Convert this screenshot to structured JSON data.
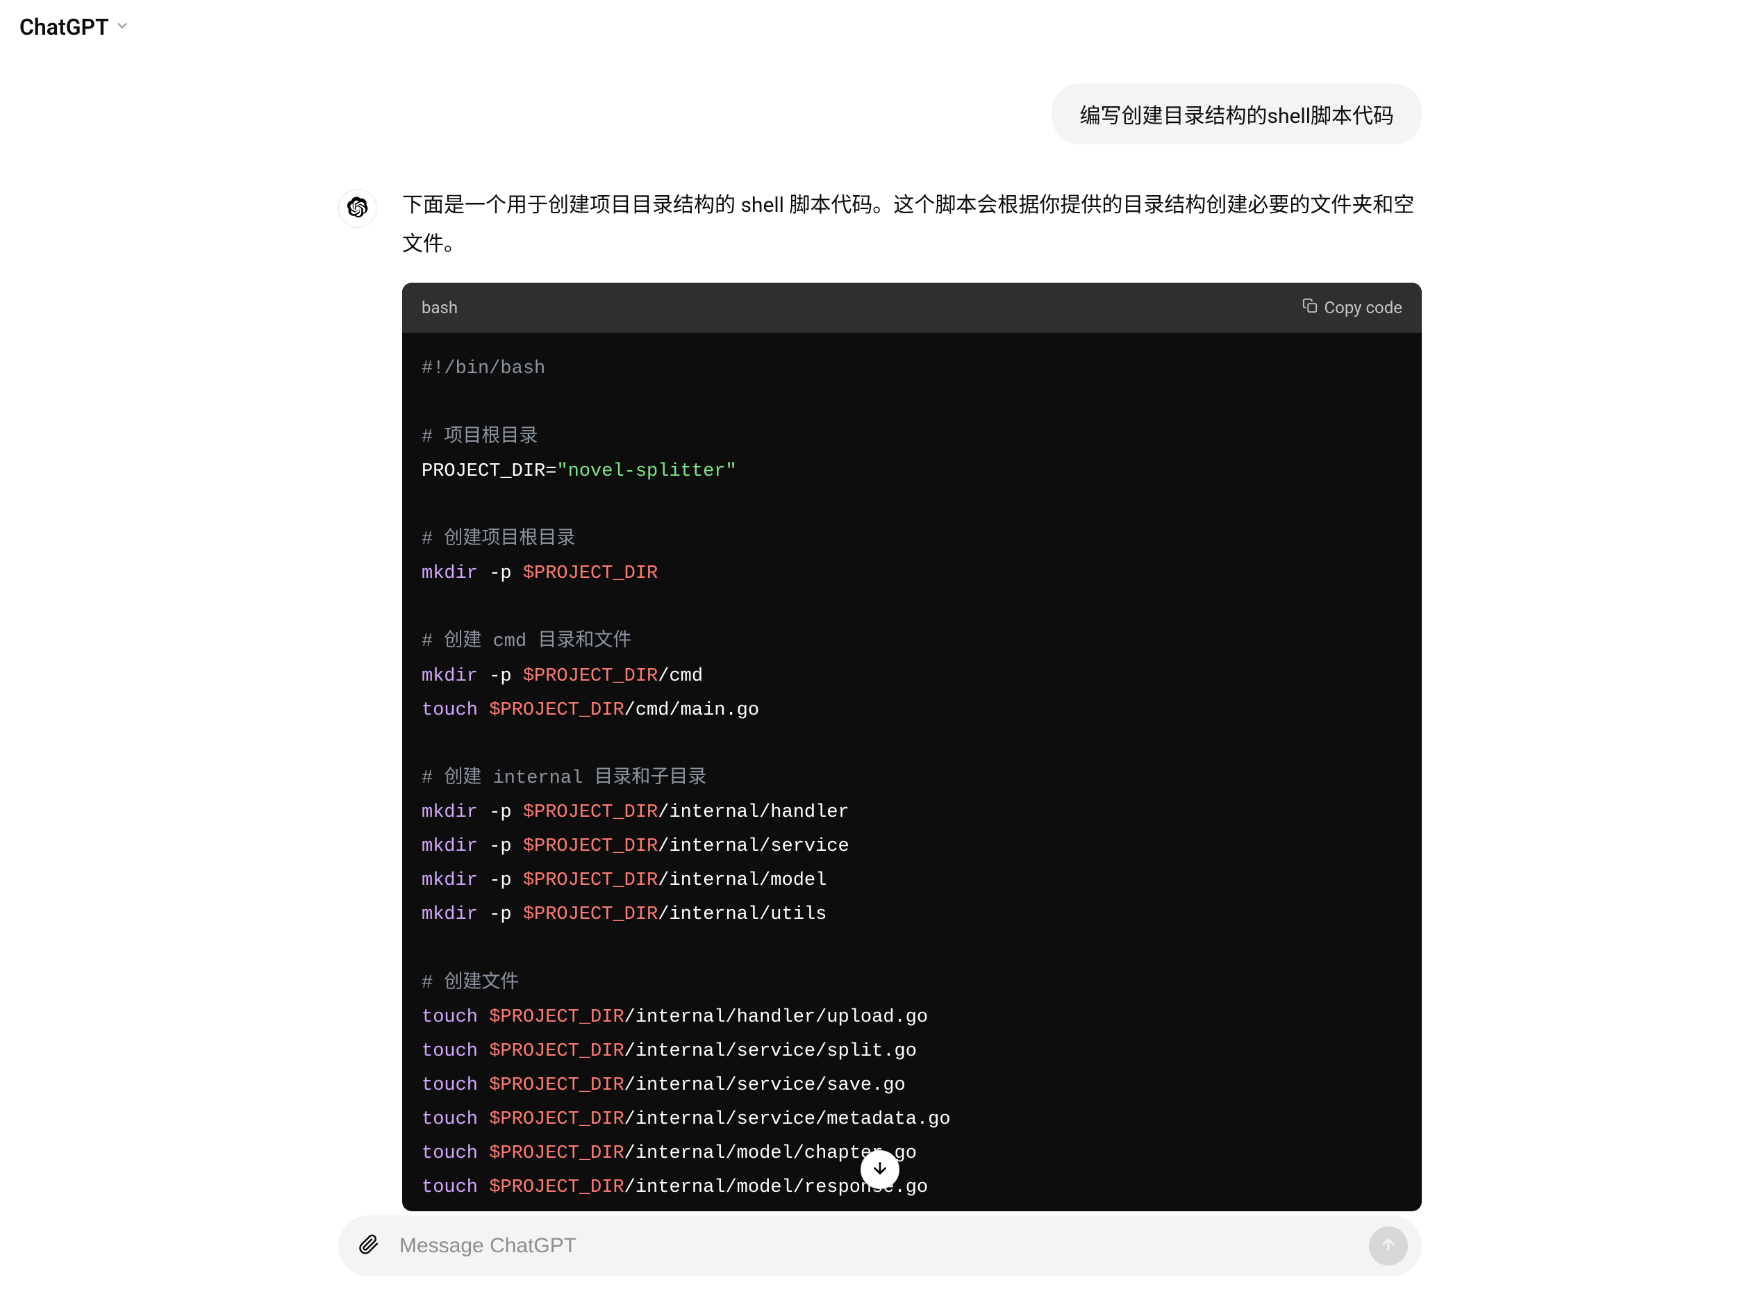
{
  "header": {
    "title": "ChatGPT"
  },
  "chat": {
    "user_message": "编写创建目录结构的shell脚本代码",
    "assistant_intro": "下面是一个用于创建项目目录结构的 shell 脚本代码。这个脚本会根据你提供的目录结构创建必要的文件夹和空文件。"
  },
  "code": {
    "language": "bash",
    "copy_label": "Copy code",
    "lines": [
      {
        "t": "plain",
        "text": "#!/bin/bash"
      },
      {
        "t": "blank"
      },
      {
        "t": "comment",
        "text": "# 项目根目录"
      },
      {
        "t": "assign",
        "left": "PROJECT_DIR=",
        "str": "\"novel-splitter\""
      },
      {
        "t": "blank"
      },
      {
        "t": "comment",
        "text": "# 创建项目根目录"
      },
      {
        "t": "cmd",
        "kw": "mkdir",
        "flag": " -p ",
        "var": "$PROJECT_DIR",
        "path": ""
      },
      {
        "t": "blank"
      },
      {
        "t": "comment",
        "text": "# 创建 cmd 目录和文件"
      },
      {
        "t": "cmd",
        "kw": "mkdir",
        "flag": " -p ",
        "var": "$PROJECT_DIR",
        "path": "/cmd"
      },
      {
        "t": "cmd",
        "kw": "touch",
        "flag": " ",
        "var": "$PROJECT_DIR",
        "path": "/cmd/main.go"
      },
      {
        "t": "blank"
      },
      {
        "t": "comment",
        "text": "# 创建 internal 目录和子目录"
      },
      {
        "t": "cmd",
        "kw": "mkdir",
        "flag": " -p ",
        "var": "$PROJECT_DIR",
        "path": "/internal/handler"
      },
      {
        "t": "cmd",
        "kw": "mkdir",
        "flag": " -p ",
        "var": "$PROJECT_DIR",
        "path": "/internal/service"
      },
      {
        "t": "cmd",
        "kw": "mkdir",
        "flag": " -p ",
        "var": "$PROJECT_DIR",
        "path": "/internal/model"
      },
      {
        "t": "cmd",
        "kw": "mkdir",
        "flag": " -p ",
        "var": "$PROJECT_DIR",
        "path": "/internal/utils"
      },
      {
        "t": "blank"
      },
      {
        "t": "comment",
        "text": "# 创建文件"
      },
      {
        "t": "cmd",
        "kw": "touch",
        "flag": " ",
        "var": "$PROJECT_DIR",
        "path": "/internal/handler/upload.go"
      },
      {
        "t": "cmd",
        "kw": "touch",
        "flag": " ",
        "var": "$PROJECT_DIR",
        "path": "/internal/service/split.go"
      },
      {
        "t": "cmd",
        "kw": "touch",
        "flag": " ",
        "var": "$PROJECT_DIR",
        "path": "/internal/service/save.go"
      },
      {
        "t": "cmd",
        "kw": "touch",
        "flag": " ",
        "var": "$PROJECT_DIR",
        "path": "/internal/service/metadata.go"
      },
      {
        "t": "cmd",
        "kw": "touch",
        "flag": " ",
        "var": "$PROJECT_DIR",
        "path": "/internal/model/chapter.go"
      },
      {
        "t": "cmd",
        "kw": "touch",
        "flag": " ",
        "var": "$PROJECT_DIR",
        "path": "/internal/model/response.go"
      }
    ]
  },
  "composer": {
    "placeholder": "Message ChatGPT"
  }
}
